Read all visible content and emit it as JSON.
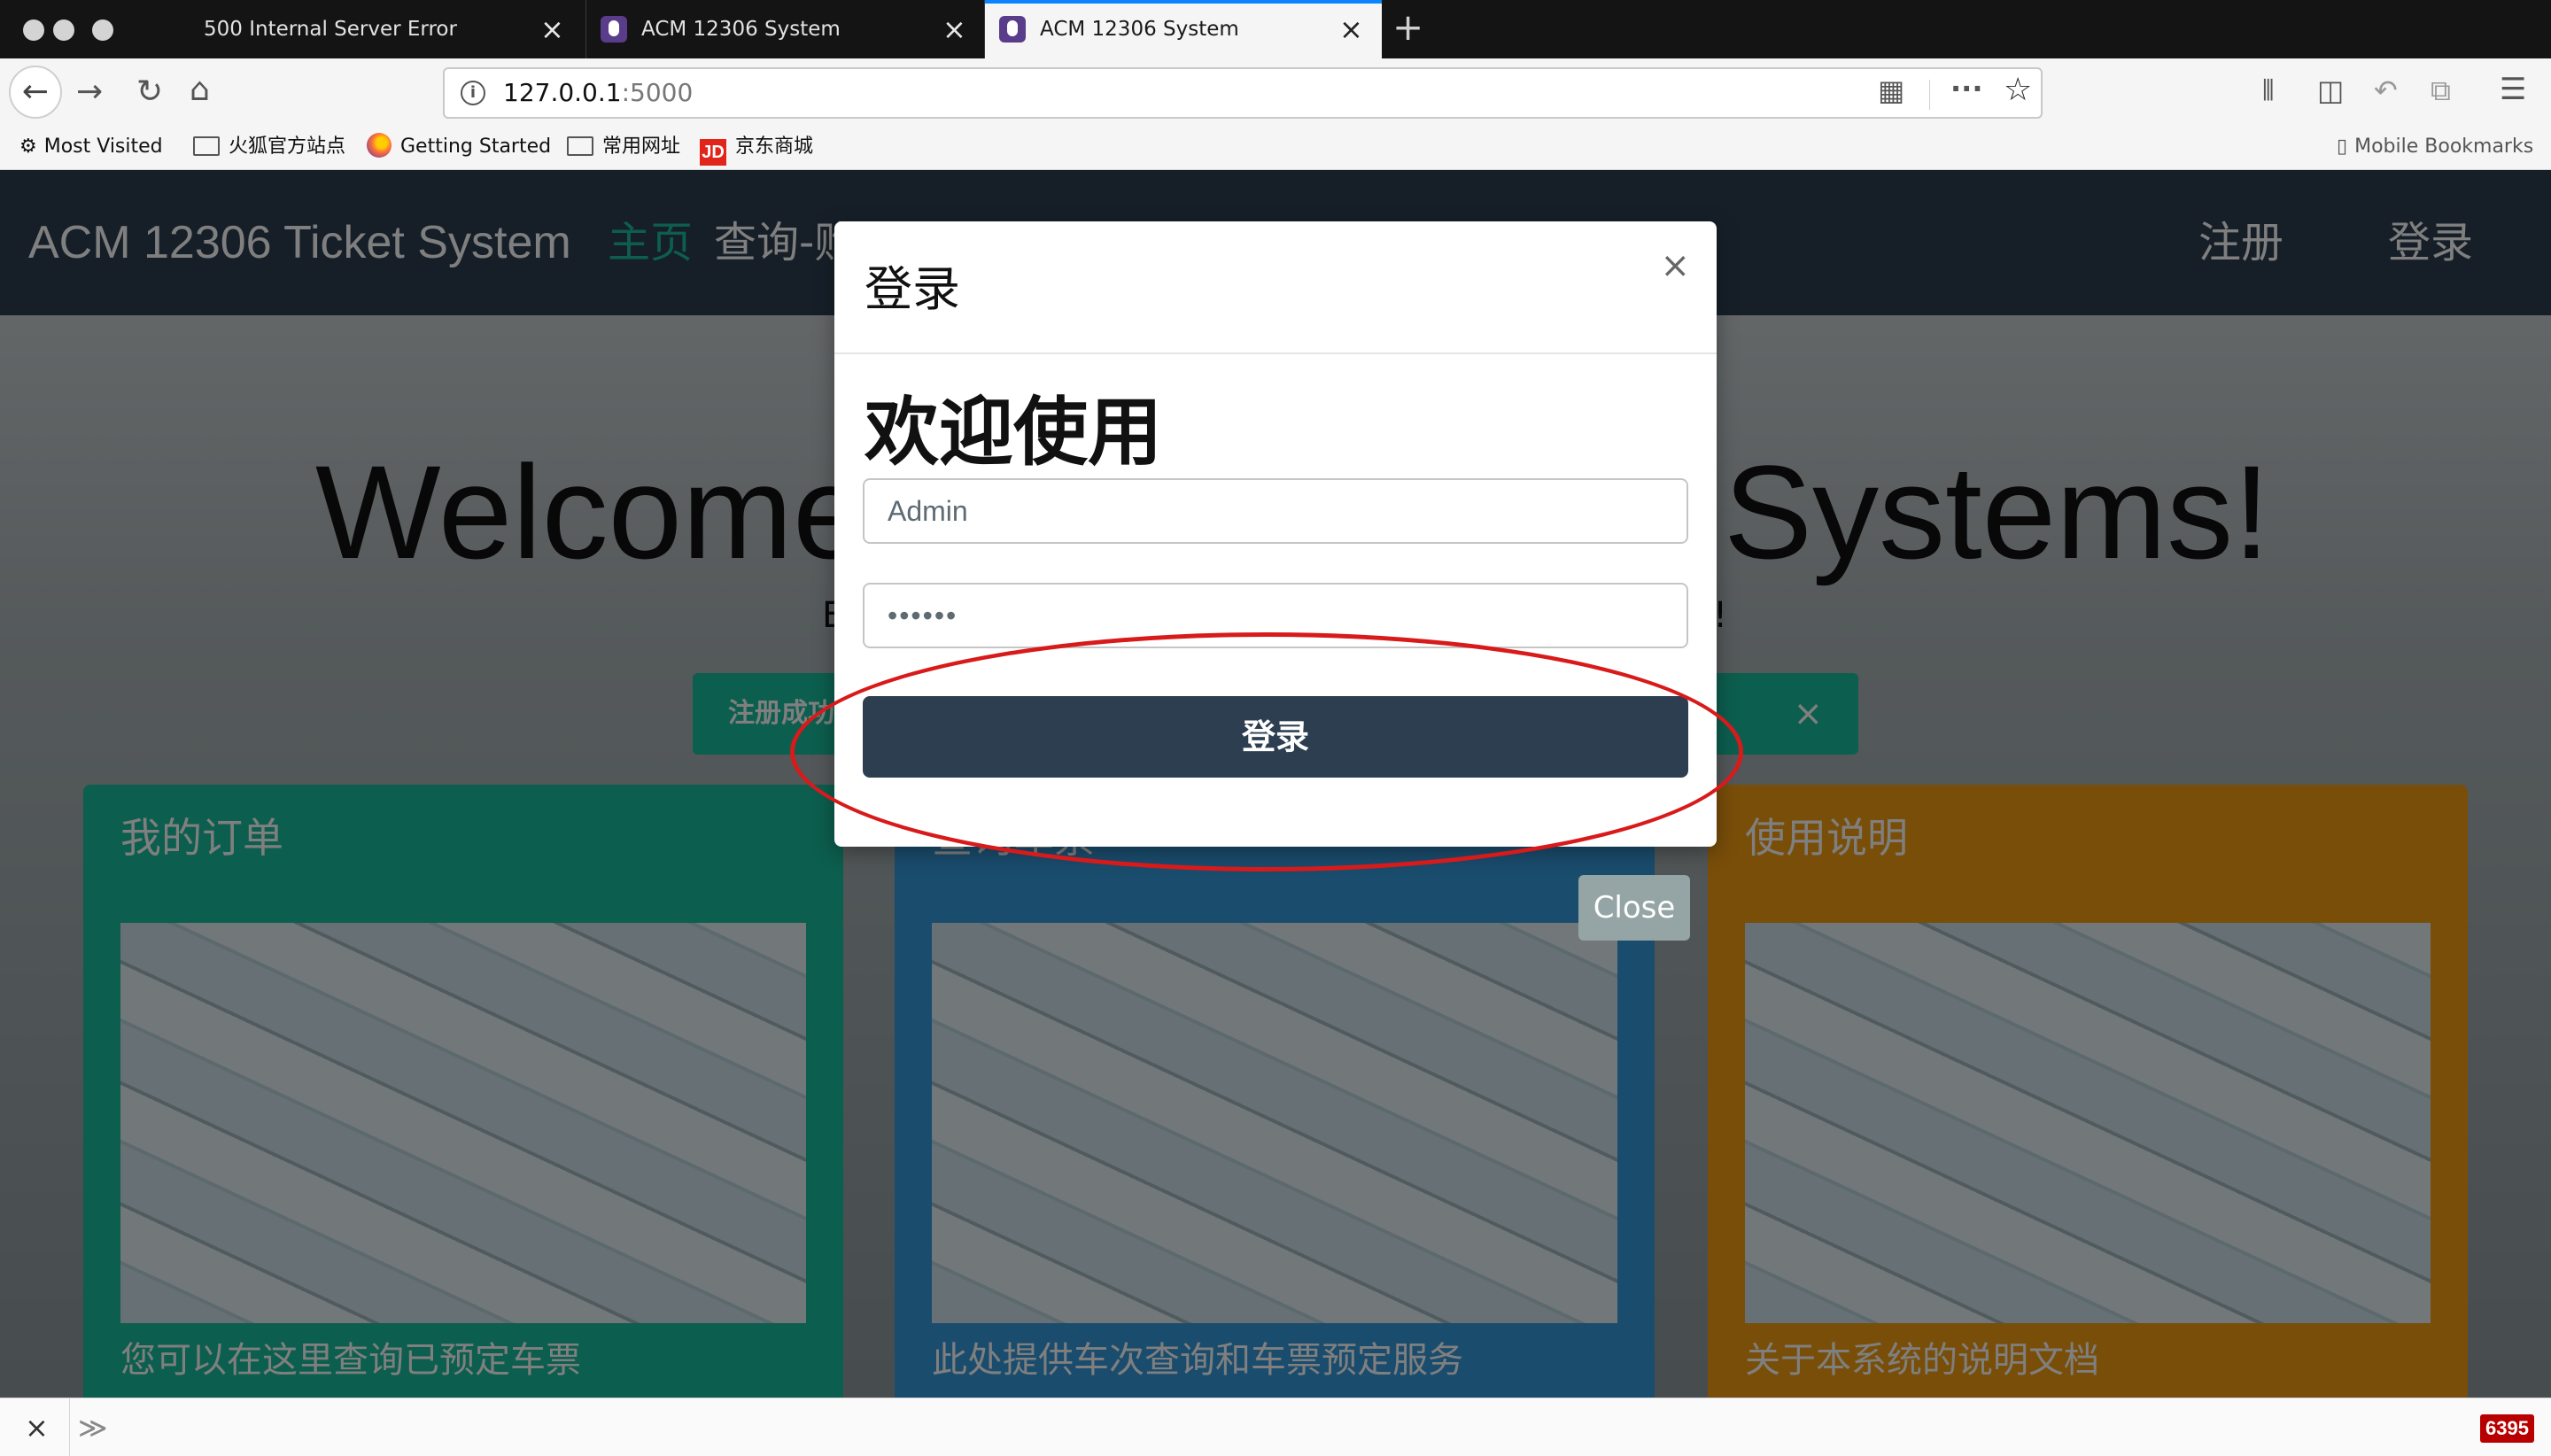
{
  "browser": {
    "tabs": [
      {
        "title": "500 Internal Server Error",
        "state": "inactive",
        "has_favicon": false
      },
      {
        "title": "ACM 12306 System",
        "state": "inactive",
        "has_favicon": true
      },
      {
        "title": "ACM 12306 System",
        "state": "active",
        "has_favicon": true
      }
    ],
    "new_tab_label": "+",
    "url": {
      "host": "127.0.0.1",
      "port": ":5000"
    },
    "bookmarks": [
      {
        "label": "Most Visited",
        "icon": "gear-icon"
      },
      {
        "label": "火狐官方站点",
        "icon": "folder-icon"
      },
      {
        "label": "Getting Started",
        "icon": "firefox-icon"
      },
      {
        "label": "常用网址",
        "icon": "folder-icon"
      },
      {
        "label": "京东商城",
        "icon": "jd-icon"
      }
    ],
    "mobile_bookmarks": "Mobile Bookmarks",
    "accent_color": "#0a84ff"
  },
  "site": {
    "brand": "ACM 12306 Ticket System",
    "nav": [
      {
        "label": "主页",
        "active": true
      },
      {
        "label": "查询-购",
        "active": false
      }
    ],
    "nav_right": [
      {
        "label": "注册"
      },
      {
        "label": "登录"
      }
    ],
    "hero": {
      "title_left": "Welcome",
      "title_right": "Systems!",
      "sub_left": "E",
      "sub_right": "!"
    },
    "alert": {
      "text": "注册成功",
      "close": "×",
      "color": "#18bc9c"
    },
    "cards": [
      {
        "title": "我的订单",
        "desc": "您可以在这里查询已预定车票",
        "color": "#18bc9c"
      },
      {
        "title": "查询车票",
        "desc": "此处提供车次查询和车票预定服务",
        "color": "#3498db"
      },
      {
        "title": "使用说明",
        "desc": "关于本系统的说明文档",
        "color": "#f39c12"
      }
    ],
    "navbar_color": "#2c3e50"
  },
  "modal": {
    "title": "登录",
    "close": "×",
    "heading": "欢迎使用",
    "username_value": "Admin",
    "password_value": "••••••",
    "submit_label": "登录",
    "annotation_color": "#d81a1a"
  },
  "behind_close_button": "Close",
  "bottom_bar": {
    "close": "×",
    "expand": "≫",
    "badge": "6395"
  }
}
